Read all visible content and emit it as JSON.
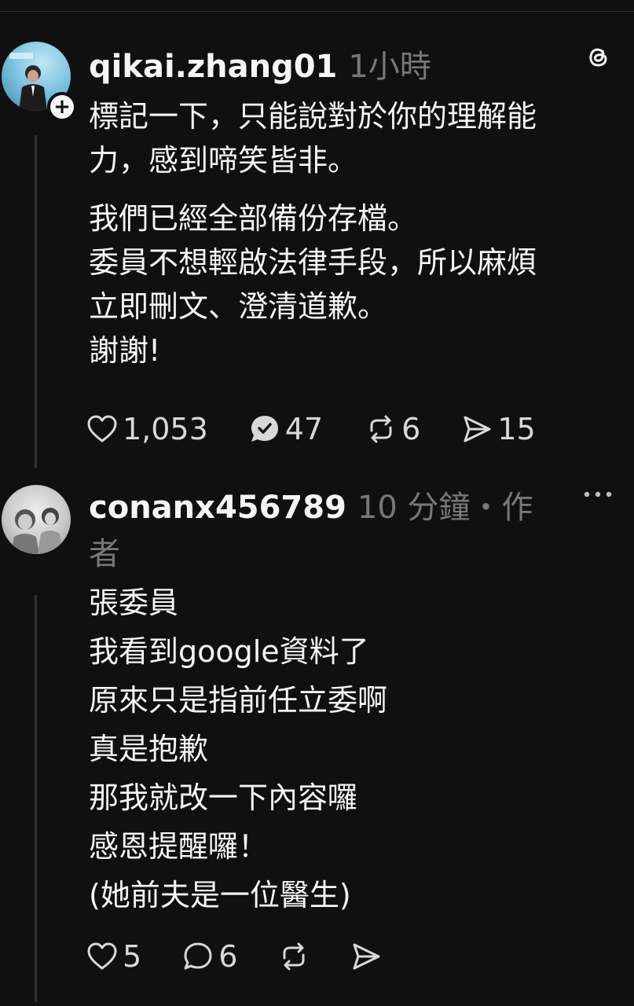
{
  "colors": {
    "background": "#101010",
    "text": "#f3f5f7",
    "meta": "#777777",
    "thread_line": "#333333"
  },
  "posts": [
    {
      "username": "qikai.zhang01",
      "time": "1小時",
      "badge_icon": "plus-icon",
      "corner_icon": "threads-logo-icon",
      "paragraphs": [
        [
          "標記一下，只能說對於你的理解能",
          "力，感到啼笑皆非。"
        ],
        [
          "我們已經全部備份存檔。",
          "委員不想輕啟法律手段，所以麻煩",
          "立即刪文、澄清道歉。",
          "謝謝!"
        ]
      ],
      "actions": {
        "likes": "1,053",
        "replies": "47",
        "reposts": "6",
        "shares": "15"
      }
    },
    {
      "username": "conanx456789",
      "time": "10 分鐘",
      "author_tag_1": "・作",
      "author_tag_2": "者",
      "corner_icon": "more-options-icon",
      "paragraphs": [
        [
          "張委員",
          "我看到google資料了",
          "原來只是指前任立委啊",
          "真是抱歉",
          "那我就改一下內容囉",
          "感恩提醒囉！",
          "(她前夫是一位醫生)"
        ]
      ],
      "actions": {
        "likes": "5",
        "replies": "6",
        "reposts": "",
        "shares": ""
      }
    }
  ]
}
